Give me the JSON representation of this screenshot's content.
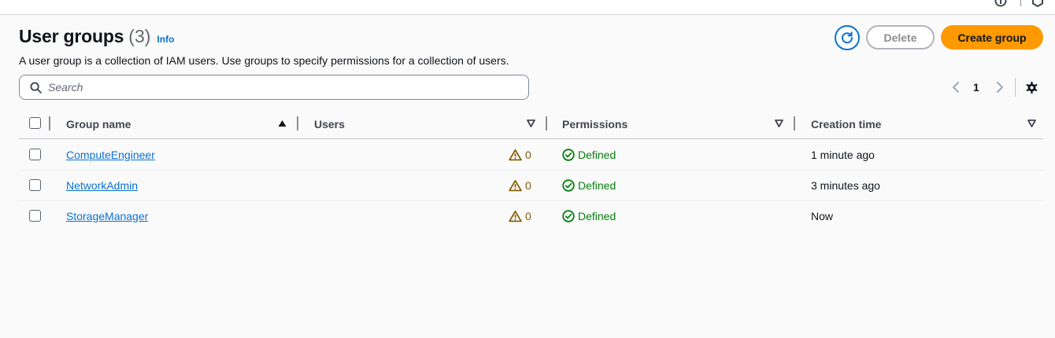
{
  "header": {
    "title": "User groups",
    "count": "(3)",
    "info_label": "Info",
    "description": "A user group is a collection of IAM users. Use groups to specify permissions for a collection of users."
  },
  "actions": {
    "refresh_icon": "refresh-icon",
    "delete_label": "Delete",
    "create_label": "Create group"
  },
  "search": {
    "placeholder": "Search",
    "value": ""
  },
  "pagination": {
    "current_page": "1"
  },
  "table": {
    "columns": [
      "Group name",
      "Users",
      "Permissions",
      "Creation time"
    ],
    "sorted_column": "Group name",
    "rows": [
      {
        "group_name": "ComputeEngineer",
        "users": "0",
        "permissions": "Defined",
        "creation_time": "1 minute ago"
      },
      {
        "group_name": "NetworkAdmin",
        "users": "0",
        "permissions": "Defined",
        "creation_time": "3 minutes ago"
      },
      {
        "group_name": "StorageManager",
        "users": "0",
        "permissions": "Defined",
        "creation_time": "Now"
      }
    ]
  },
  "colors": {
    "accent": "#0972d3",
    "primary_button": "#ff9900",
    "success": "#037f0c",
    "warning": "#855900",
    "background": "#fafafa"
  }
}
